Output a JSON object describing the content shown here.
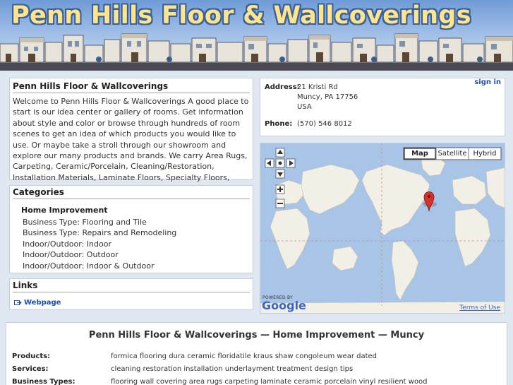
{
  "header": {
    "title": "Penn Hills Floor & Wallcoverings"
  },
  "about": {
    "heading": "Penn Hills Floor & Wallcoverings",
    "text": "Welcome to Penn Hills Floor & Wallcoverings A good place to start is our idea center or gallery of rooms. Get information about style and color or browse through hundreds of room scenes to get an idea of which products you would like to use. Or maybe take a stroll through our showroom and explore our many products and brands. We carry Area Rugs, Carpeting, Ceramic/Porcelain, Cleaning/Restoration, Installation Materials, Laminate Floors, Specialty Floors, Underlayment, Vinyl/Resilient, Wall Coverings, Wood Flooring, and more..."
  },
  "categories": {
    "heading": "Categories",
    "group": "Home Improvement",
    "items": [
      "Business Type: Flooring and Tile",
      "Business Type: Repairs and Remodeling",
      "Indoor/Outdoor: Indoor",
      "Indoor/Outdoor: Outdoor",
      "Indoor/Outdoor: Indoor & Outdoor"
    ]
  },
  "links": {
    "heading": "Links",
    "webpage": "Webpage"
  },
  "contact": {
    "signin": "sign in",
    "address_label": "Address:",
    "address_lines": [
      "21 Kristi Rd",
      "Muncy, PA 17756",
      "USA"
    ],
    "phone_label": "Phone:",
    "phone": "(570) 546 8012"
  },
  "map": {
    "types": [
      "Map",
      "Satellite",
      "Hybrid"
    ],
    "selected_type": "Map",
    "powered_by": "POWERED BY",
    "google": "Google",
    "terms": "Terms of Use",
    "colors": {
      "water": "#a8c4e6",
      "land": "#f2efe6",
      "marker": "#d6322a"
    }
  },
  "bottom": {
    "heading": "Penn Hills Floor & Wallcoverings — Home Improvement — Muncy",
    "products_label": "Products:",
    "products": "formica flooring dura ceramic floridatile kraus shaw congoleum wear dated",
    "services_label": "Services:",
    "services": "cleaning restoration installation underlayment treatment design tips",
    "business_types_label": "Business Types:",
    "business_types": "flooring wall covering area rugs carpeting laminate ceramic porcelain vinyl resilient wood"
  }
}
